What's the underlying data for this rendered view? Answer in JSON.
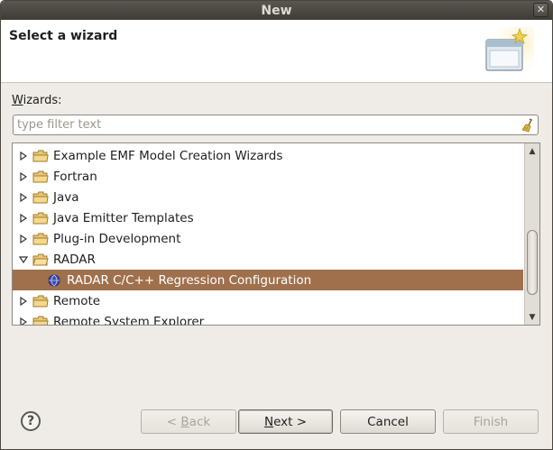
{
  "window": {
    "title": "New",
    "close_glyph": "✕"
  },
  "header": {
    "title": "Select a wizard",
    "banner_icon": "new-wizard-banner-icon"
  },
  "wizards_label": {
    "mnemonic": "W",
    "rest": "izards:"
  },
  "filter": {
    "value": "",
    "placeholder": "type filter text",
    "clear_icon": "broom-clear-icon"
  },
  "tree": {
    "items": [
      {
        "label": "Example EMF Model Creation Wizards",
        "expanded": false
      },
      {
        "label": "Fortran",
        "expanded": false
      },
      {
        "label": "Java",
        "expanded": false
      },
      {
        "label": "Java Emitter Templates",
        "expanded": false
      },
      {
        "label": "Plug-in Development",
        "expanded": false
      },
      {
        "label": "RADAR",
        "expanded": true
      },
      {
        "label": "RADAR C/C++ Regression Configuration",
        "selected": true
      },
      {
        "label": "Remote",
        "expanded": false
      },
      {
        "label": "Remote System Explorer",
        "expanded": false
      }
    ]
  },
  "buttons": {
    "help_glyph": "?",
    "back": {
      "prefix": "< ",
      "mnemonic": "B",
      "rest": "ack",
      "enabled": false
    },
    "next": {
      "mnemonic": "N",
      "rest": "ext >",
      "enabled": true
    },
    "cancel": {
      "label": "Cancel",
      "enabled": true
    },
    "finish": {
      "label": "Finish",
      "enabled": false
    }
  },
  "colors": {
    "selection": "#a0704c",
    "titlebar": "#3f3c38",
    "dialog_bg": "#efebe7"
  }
}
